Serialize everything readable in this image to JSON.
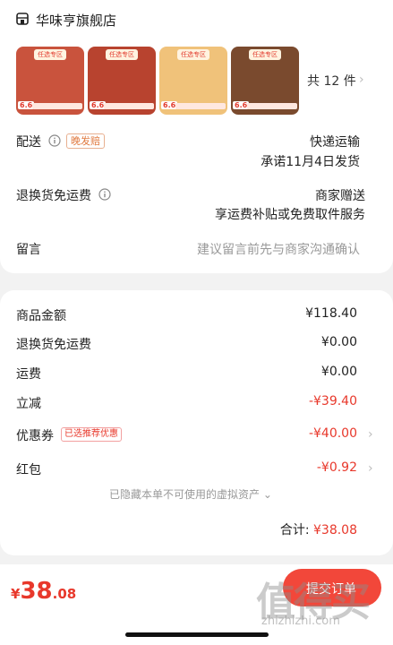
{
  "store": {
    "name": "华味亨旗舰店",
    "icon": "store-icon"
  },
  "products": {
    "count_label": "共 12 件",
    "items": [
      {
        "tag": "任选专区",
        "bg": "#c9533d"
      },
      {
        "tag": "任选专区",
        "bg": "#b8432f"
      },
      {
        "tag": "任选专区",
        "bg": "#f0c27a"
      },
      {
        "tag": "任选专区",
        "bg": "#7a4a2e"
      }
    ],
    "thumb_price": "6.6"
  },
  "shipping": {
    "label": "配送",
    "badge": "晚发赔",
    "method": "快递运输",
    "promise": "承诺11月4日发货"
  },
  "returns": {
    "label": "退换货免运费",
    "value": "商家赠送",
    "desc": "享运费补贴或免费取件服务"
  },
  "message": {
    "label": "留言",
    "placeholder": "建议留言前先与商家沟通确认"
  },
  "summary": {
    "rows": [
      {
        "label": "商品金额",
        "value": "¥118.40"
      },
      {
        "label": "退换货免运费",
        "value": "¥0.00"
      },
      {
        "label": "运费",
        "value": "¥0.00"
      },
      {
        "label": "立减",
        "value": "-¥39.40"
      },
      {
        "label": "优惠券",
        "badge": "已选推荐优惠",
        "value": "-¥40.00"
      },
      {
        "label": "红包",
        "value": "-¥0.92"
      }
    ],
    "hidden_note": "已隐藏本单不可使用的虚拟资产",
    "total_label": "合计:",
    "total_value": "¥38.08"
  },
  "bottom": {
    "currency": "¥",
    "price_int": "38",
    "price_dec": ".08",
    "pay_label": "提交订单"
  },
  "watermark": {
    "text": "值得买",
    "url": "zhizhizhi.com"
  },
  "colors": {
    "accent": "#e8382b",
    "pay_button": "#f2473a"
  }
}
